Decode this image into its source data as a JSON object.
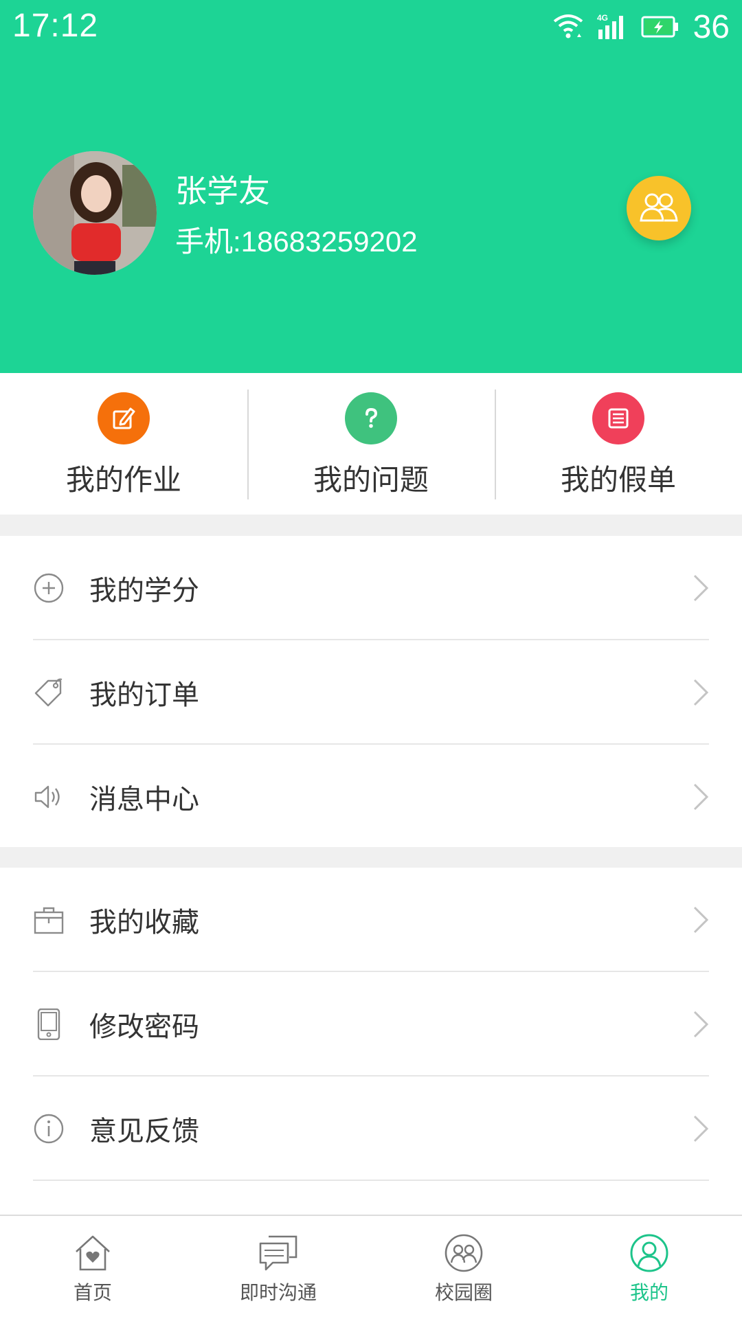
{
  "status_bar": {
    "time": "17:12",
    "battery": "36",
    "network": "4G"
  },
  "profile": {
    "name": "张学友",
    "phone": "手机:18683259202"
  },
  "colors": {
    "brand": "#1dd495",
    "homework": "#f5700b",
    "question": "#3fc27e",
    "leave": "#f0405a",
    "group": "#f8c22a"
  },
  "quick_actions": [
    {
      "label": "我的作业",
      "icon": "edit-icon"
    },
    {
      "label": "我的问题",
      "icon": "question-icon"
    },
    {
      "label": "我的假单",
      "icon": "list-icon"
    }
  ],
  "menu_group_1": [
    {
      "label": "我的学分",
      "icon": "plus-circle-icon"
    },
    {
      "label": "我的订单",
      "icon": "tag-icon"
    },
    {
      "label": "消息中心",
      "icon": "speaker-icon"
    }
  ],
  "menu_group_2": [
    {
      "label": "我的收藏",
      "icon": "box-icon"
    },
    {
      "label": "修改密码",
      "icon": "phone-icon"
    },
    {
      "label": "意见反馈",
      "icon": "info-icon"
    }
  ],
  "tabs": [
    {
      "label": "首页",
      "icon": "home-icon"
    },
    {
      "label": "即时沟通",
      "icon": "chat-icon"
    },
    {
      "label": "校园圈",
      "icon": "campus-icon"
    },
    {
      "label": "我的",
      "icon": "user-icon",
      "active": true
    }
  ]
}
